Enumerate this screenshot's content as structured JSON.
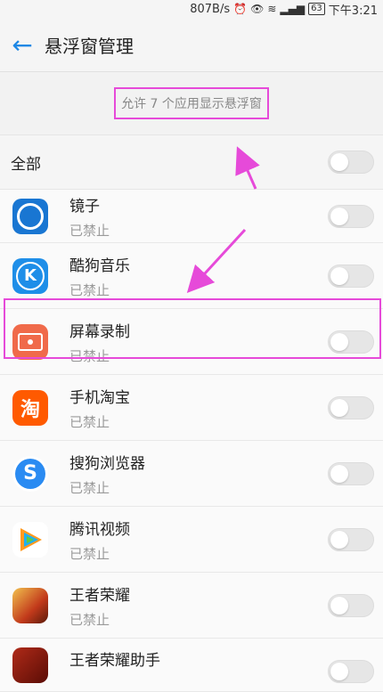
{
  "statusbar": {
    "speed": "807B/s",
    "battery": "63",
    "time": "下午3:21"
  },
  "header": {
    "title": "悬浮窗管理"
  },
  "hint": "允许 7 个应用显示悬浮窗",
  "all_label": "全部",
  "apps": [
    {
      "name": "镜子",
      "status": "已禁止",
      "icon": "mirror-icon",
      "color": "#1976d2"
    },
    {
      "name": "酷狗音乐",
      "status": "已禁止",
      "icon": "kugou-icon",
      "color": "#1e8ee8"
    },
    {
      "name": "屏幕录制",
      "status": "已禁止",
      "icon": "screen-record-icon",
      "color": "#f06a4a"
    },
    {
      "name": "手机淘宝",
      "status": "已禁止",
      "icon": "taobao-icon",
      "color": "#ff5a00"
    },
    {
      "name": "搜狗浏览器",
      "status": "已禁止",
      "icon": "sogou-browser-icon",
      "color": "#2a8bf2"
    },
    {
      "name": "腾讯视频",
      "status": "已禁止",
      "icon": "tencent-video-icon",
      "color": "#20b0f0"
    },
    {
      "name": "王者荣耀",
      "status": "已禁止",
      "icon": "honor-of-kings-icon",
      "color": "#c23a1b"
    },
    {
      "name": "王者荣耀助手",
      "status": "",
      "icon": "honor-of-kings-helper-icon",
      "color": "#8b1a10"
    }
  ]
}
